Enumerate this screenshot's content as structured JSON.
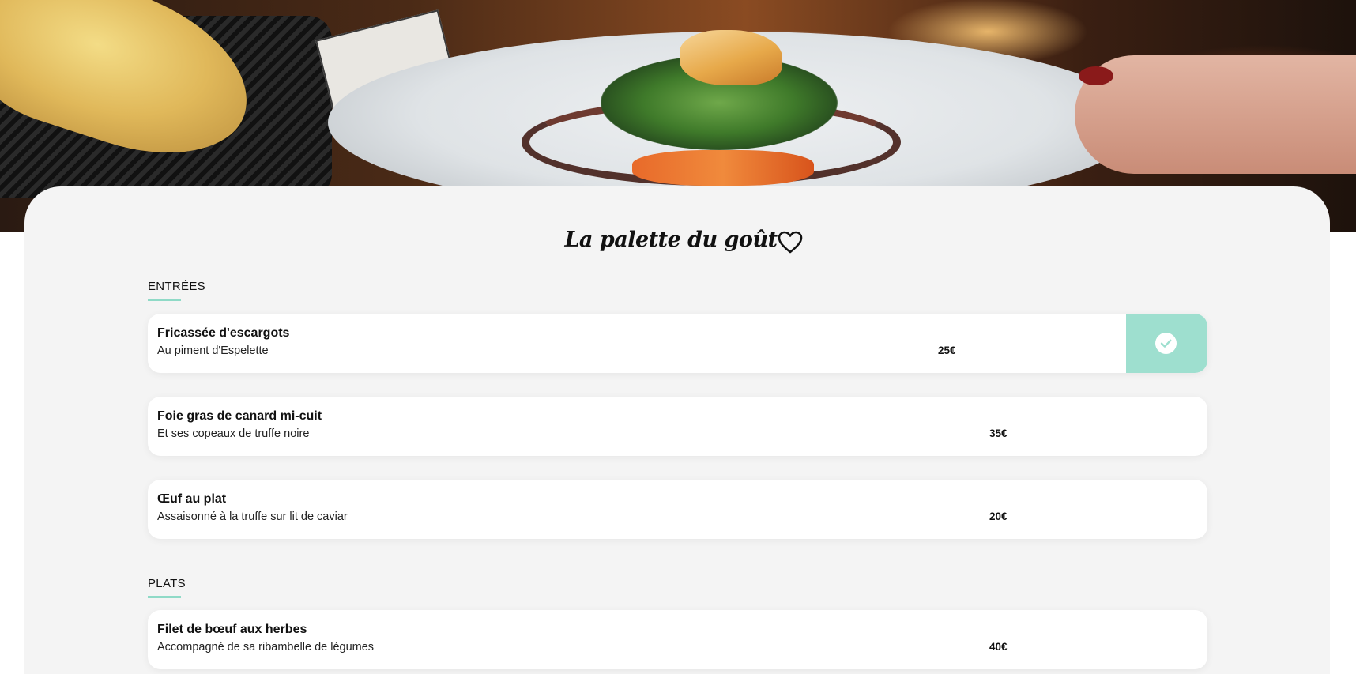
{
  "restaurant": {
    "title": "La palette du goût"
  },
  "sections": [
    {
      "heading": "ENTRÉES",
      "items": [
        {
          "name": "Fricassée d'escargots",
          "description": "Au piment d'Espelette",
          "price": "25€",
          "selected": true
        },
        {
          "name": "Foie gras de canard mi-cuit",
          "description": "Et ses copeaux de truffe noire",
          "price": "35€",
          "selected": false
        },
        {
          "name": "Œuf au plat",
          "description": "Assaisonné à la truffe sur lit de caviar",
          "price": "20€",
          "selected": false
        }
      ]
    },
    {
      "heading": "PLATS",
      "items": [
        {
          "name": "Filet de bœuf aux herbes",
          "description": "Accompagné de sa ribambelle de légumes",
          "price": "40€",
          "selected": false
        }
      ]
    }
  ],
  "icons": {
    "favorite": "heart-outline-icon",
    "selected": "check-circle-icon"
  },
  "colors": {
    "accent": "#9edfcf",
    "section_underline": "#8fdac7",
    "panel_background": "#f4f4f4",
    "card_background": "#ffffff"
  }
}
